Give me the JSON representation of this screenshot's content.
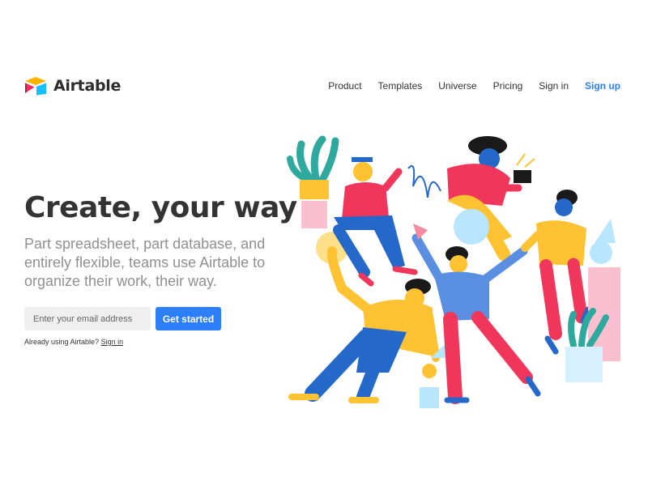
{
  "brand": {
    "name": "Airtable",
    "icon": "airtable-logo-icon",
    "colors": {
      "top": "#fcb400",
      "left": "#18bfff",
      "right": "#f82b60"
    }
  },
  "nav": {
    "items": [
      "Product",
      "Templates",
      "Universe",
      "Pricing",
      "Sign in"
    ],
    "signup_label": "Sign up"
  },
  "hero": {
    "title": "Create, your way",
    "subtitle": "Part spreadsheet, part database, and entirely flexible, teams use Airtable to organize their work, their way."
  },
  "form": {
    "email_placeholder": "Enter your email address",
    "email_value": "",
    "submit_label": "Get started"
  },
  "signin_prompt": {
    "text": "Already using Airtable?",
    "link": "Sign in"
  },
  "theme": {
    "accent": "#2d7ff9",
    "text": "#333333",
    "muted": "#909090",
    "input_bg": "#efefef"
  },
  "illustration": {
    "name": "team-collaboration-illustration",
    "palette": [
      "#ffc233",
      "#f0365a",
      "#2468c9",
      "#5a8ee0",
      "#fbc0cf",
      "#b9e6ff",
      "#2fa89d"
    ]
  }
}
